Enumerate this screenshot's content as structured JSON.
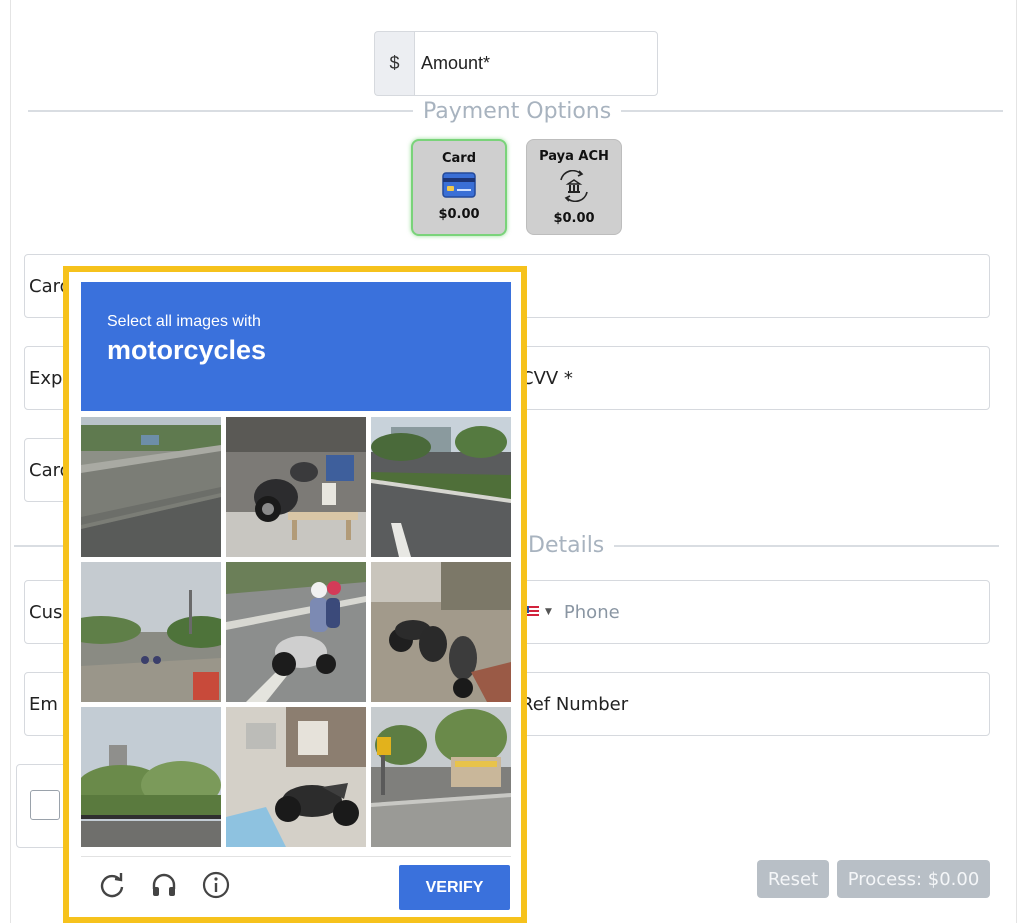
{
  "form": {
    "currency_symbol": "$",
    "amount_placeholder": "Amount*",
    "payment_options_legend": "Payment Options",
    "payment_options": [
      {
        "label": "Card",
        "amount": "$0.00",
        "icon": "credit-card-icon",
        "selected": true
      },
      {
        "label": "Paya ACH",
        "amount": "$0.00",
        "icon": "bank-transfer-icon",
        "selected": false
      }
    ],
    "card_number_label": "Card",
    "expiry_label": "Expi",
    "cvv_label": "CVV *",
    "card_holder_label": "Card",
    "details_legend": "Details",
    "customer_label": "Cus",
    "phone_placeholder": "Phone",
    "email_label": "Em",
    "ref_number_label": "Ref Number",
    "reset_label": "Reset",
    "process_label": "Process: $0.00"
  },
  "captcha": {
    "instruction": "Select all images with",
    "target": "motorcycles",
    "verify_label": "VERIFY",
    "controls": [
      "reload-icon",
      "headphones-icon",
      "info-icon"
    ],
    "tiles": [
      {
        "scene": "highway-barrier",
        "has_motorcycle": false
      },
      {
        "scene": "parked-motorcycles-with-bench",
        "has_motorcycle": true
      },
      {
        "scene": "road-median-trees",
        "has_motorcycle": false
      },
      {
        "scene": "road-with-distant-riders",
        "has_motorcycle": true
      },
      {
        "scene": "rider-on-motorcycle",
        "has_motorcycle": true
      },
      {
        "scene": "parked-scooters",
        "has_motorcycle": true
      },
      {
        "scene": "trees-and-fence",
        "has_motorcycle": false
      },
      {
        "scene": "sport-motorcycle-by-pool",
        "has_motorcycle": true
      },
      {
        "scene": "street-corner-sign",
        "has_motorcycle": false
      }
    ]
  },
  "colors": {
    "captcha_blue": "#3a71dc",
    "frame_yellow": "#f6c21c",
    "selected_green": "#7ad37a",
    "button_disabled": "#b8bfc6"
  }
}
